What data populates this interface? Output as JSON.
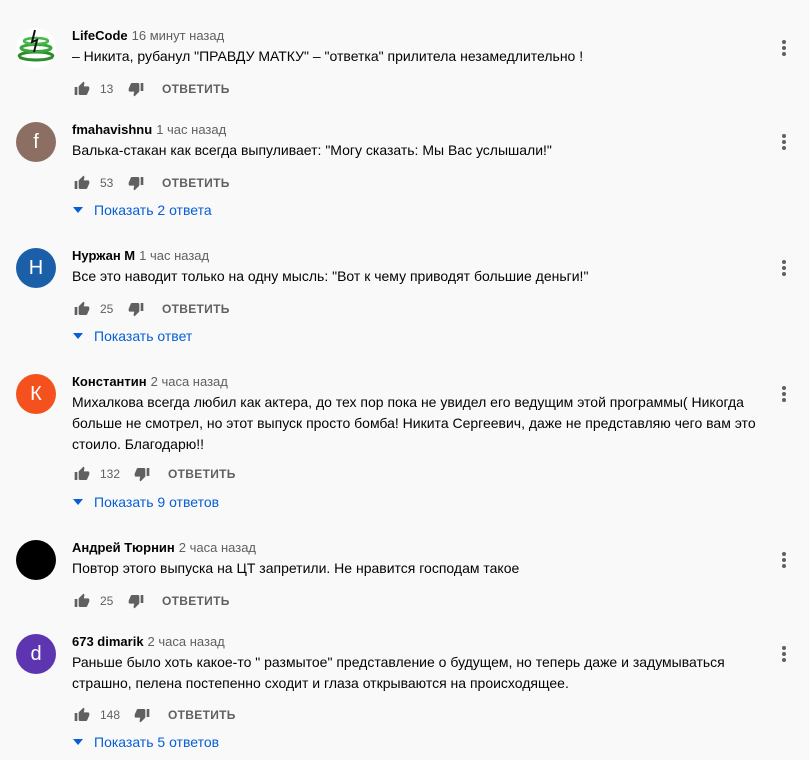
{
  "comments": [
    {
      "author": "LifeCode",
      "time": "16 минут назад",
      "text": "– Никита, рубанул \"ПРАВДУ МАТКУ\" – \"ответка\" прилитела незамедлительно !",
      "likes": "13",
      "reply_label": "ОТВЕТИТЬ",
      "avatar_letter": "",
      "avatar_color": "#ffffff"
    },
    {
      "author": "fmahavishnu",
      "time": "1 час назад",
      "text": "Валька-стакан как всегда выпуливает: \"Могу сказать: Мы Вас услышали!\"",
      "likes": "53",
      "reply_label": "ОТВЕТИТЬ",
      "avatar_letter": "f",
      "avatar_color": "#8d6e63",
      "show_replies": "Показать 2 ответа"
    },
    {
      "author": "Нуржан М",
      "time": "1 час назад",
      "text": "Все это наводит только на одну мысль: \"Вот к чему приводят большие деньги!\"",
      "likes": "25",
      "reply_label": "ОТВЕТИТЬ",
      "avatar_letter": "Н",
      "avatar_color": "#1a5fa8",
      "show_replies": "Показать ответ"
    },
    {
      "author": "Константин",
      "time": "2 часа назад",
      "text": "Михалкова всегда любил как актера, до тех пор пока не увидел его ведущим этой программы( Никогда больше не смотрел, но этот выпуск просто бомба! Никита Сергеевич, даже не представляю чего вам это стоило. Благодарю!!",
      "likes": "132",
      "reply_label": "ОТВЕТИТЬ",
      "avatar_letter": "К",
      "avatar_color": "#f4511e",
      "show_replies": "Показать 9 ответов"
    },
    {
      "author": "Андрей Тюрнин",
      "time": "2 часа назад",
      "text": "Повтор этого выпуска на ЦТ запретили. Не нравится господам такое",
      "likes": "25",
      "reply_label": "ОТВЕТИТЬ",
      "avatar_letter": "",
      "avatar_color": "#000000"
    },
    {
      "author": "673 dimarik",
      "time": "2 часа назад",
      "text": "Раньше было хоть какое-то \" размытое\" представление о будущем, но теперь даже и задумываться страшно, пелена постепенно сходит и глаза открываются на происходящее.",
      "likes": "148",
      "reply_label": "ОТВЕТИТЬ",
      "avatar_letter": "d",
      "avatar_color": "#5e35b1",
      "show_replies": "Показать 5 ответов"
    }
  ],
  "icons": {
    "like": "thumb-up-icon",
    "dislike": "thumb-down-icon",
    "menu": "more-vert-icon",
    "expand": "chevron-down-icon"
  },
  "colors": {
    "link": "#065fd4",
    "secondary_text": "#606060",
    "background": "#f9f9f9"
  }
}
